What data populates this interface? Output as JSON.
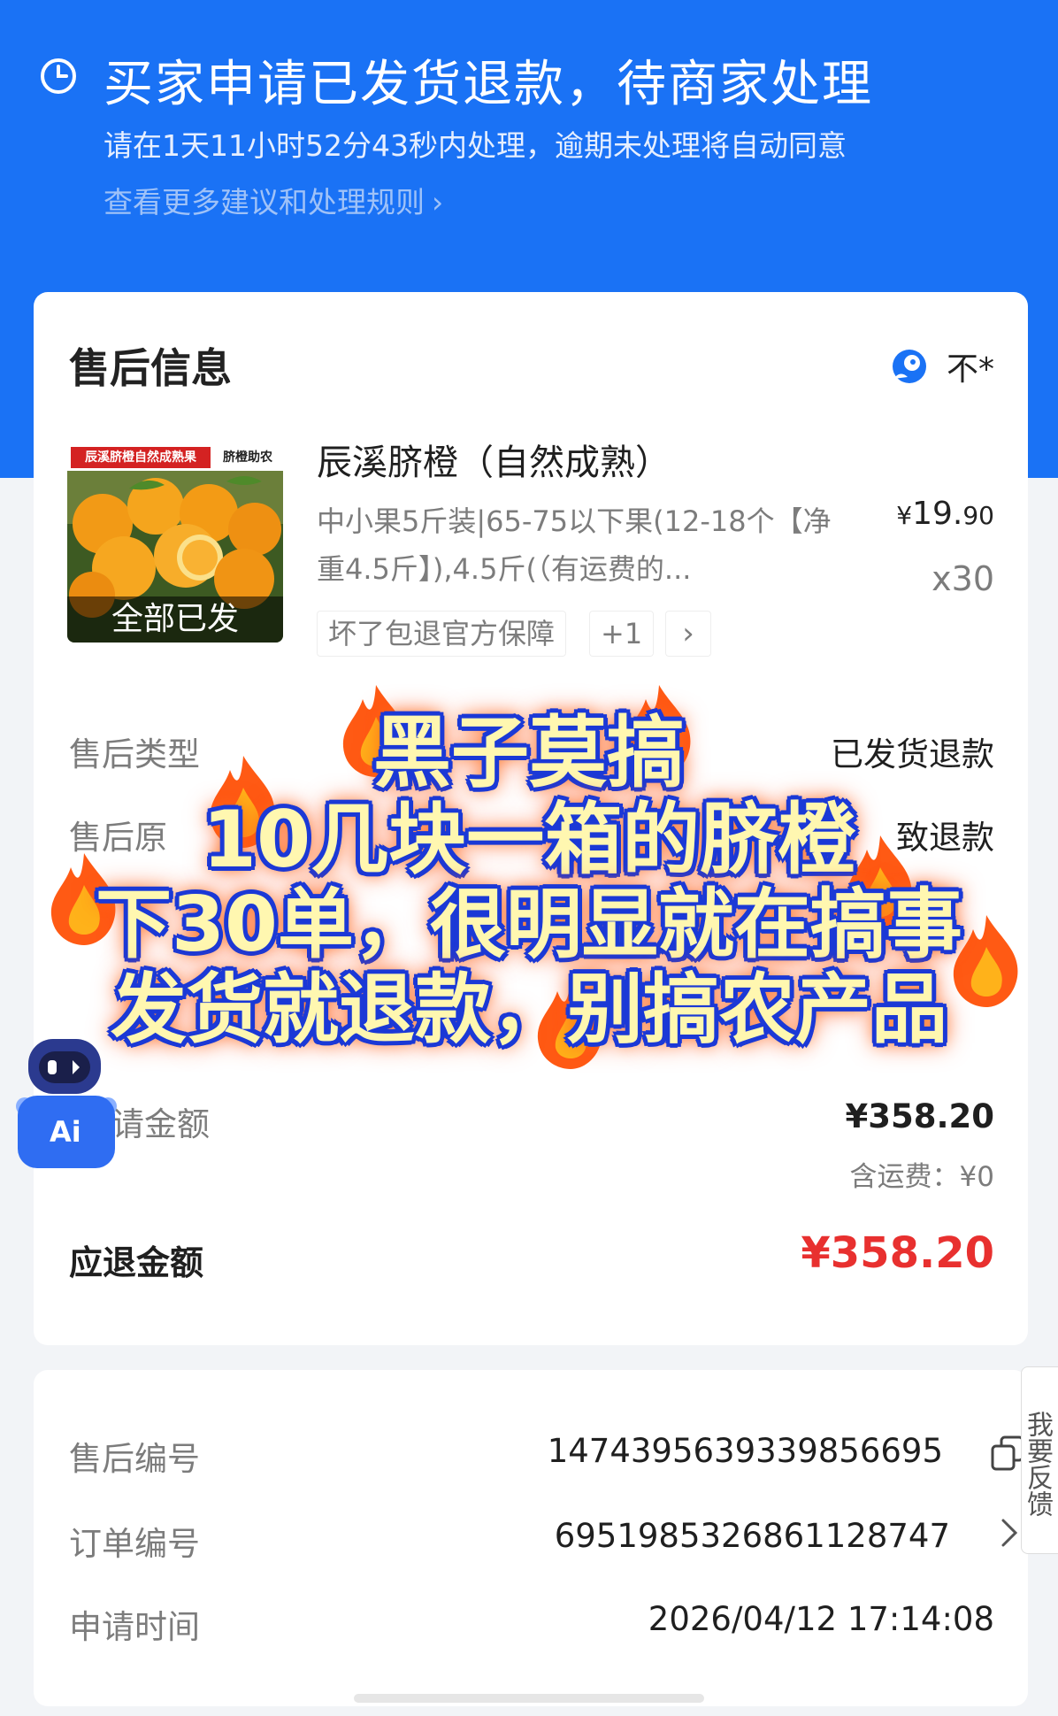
{
  "header": {
    "status_title": "买家申请已发货退款，待商家处理",
    "deadline_text": "请在1天11小时52分43秒内处理，逾期未处理将自动同意",
    "rules_link": "查看更多建议和处理规则",
    "chevron": "›"
  },
  "aftersale": {
    "section_title": "售后信息",
    "seller_name": "不*",
    "product": {
      "thumb_banner_left": "辰溪脐橙自然成熟果",
      "thumb_banner_right": "脐橙助农",
      "thumb_label": "全部已发",
      "name": "辰溪脐橙（自然成熟）",
      "spec": "中小果5斤装|65-75以下果(12-18个【净重4.5斤】),4.5斤(（有运费的...",
      "price_currency": "¥",
      "price_int": "19.",
      "price_dec": "90",
      "quantity": "x30",
      "guarantee": "坏了包退官方保障",
      "guarantee_more": "+1",
      "guarantee_chev": "›"
    },
    "rows": [
      {
        "label": "售后类型",
        "value": "已发货退款"
      },
      {
        "label": "售后原",
        "value": "致退款"
      },
      {
        "label": "请金额",
        "value": "¥358.20",
        "sub": "含运费：¥0"
      }
    ],
    "refund_label": "应退金额",
    "refund_value": "¥358.20"
  },
  "overlay": {
    "line1": "黑子莫搞",
    "line2": "10几块一箱的脐橙",
    "line3": "下30单，很明显就在搞事",
    "line4": "发货就退款，别搞农产品"
  },
  "ai_assistant": {
    "label": "Ai"
  },
  "order_info": {
    "rows": [
      {
        "label": "售后编号",
        "value": "1474395639339856695"
      },
      {
        "label": "订单编号",
        "value": "6951985326861128747"
      },
      {
        "label": "申请时间",
        "value": "2026/04/12 17:14:08"
      }
    ]
  },
  "feedback_tab": "我要反馈",
  "colors": {
    "header_blue": "#1a72f5",
    "refund_red": "#e8302f",
    "overlay_text": "#fff7b0",
    "overlay_stroke": "#1b39d6"
  }
}
